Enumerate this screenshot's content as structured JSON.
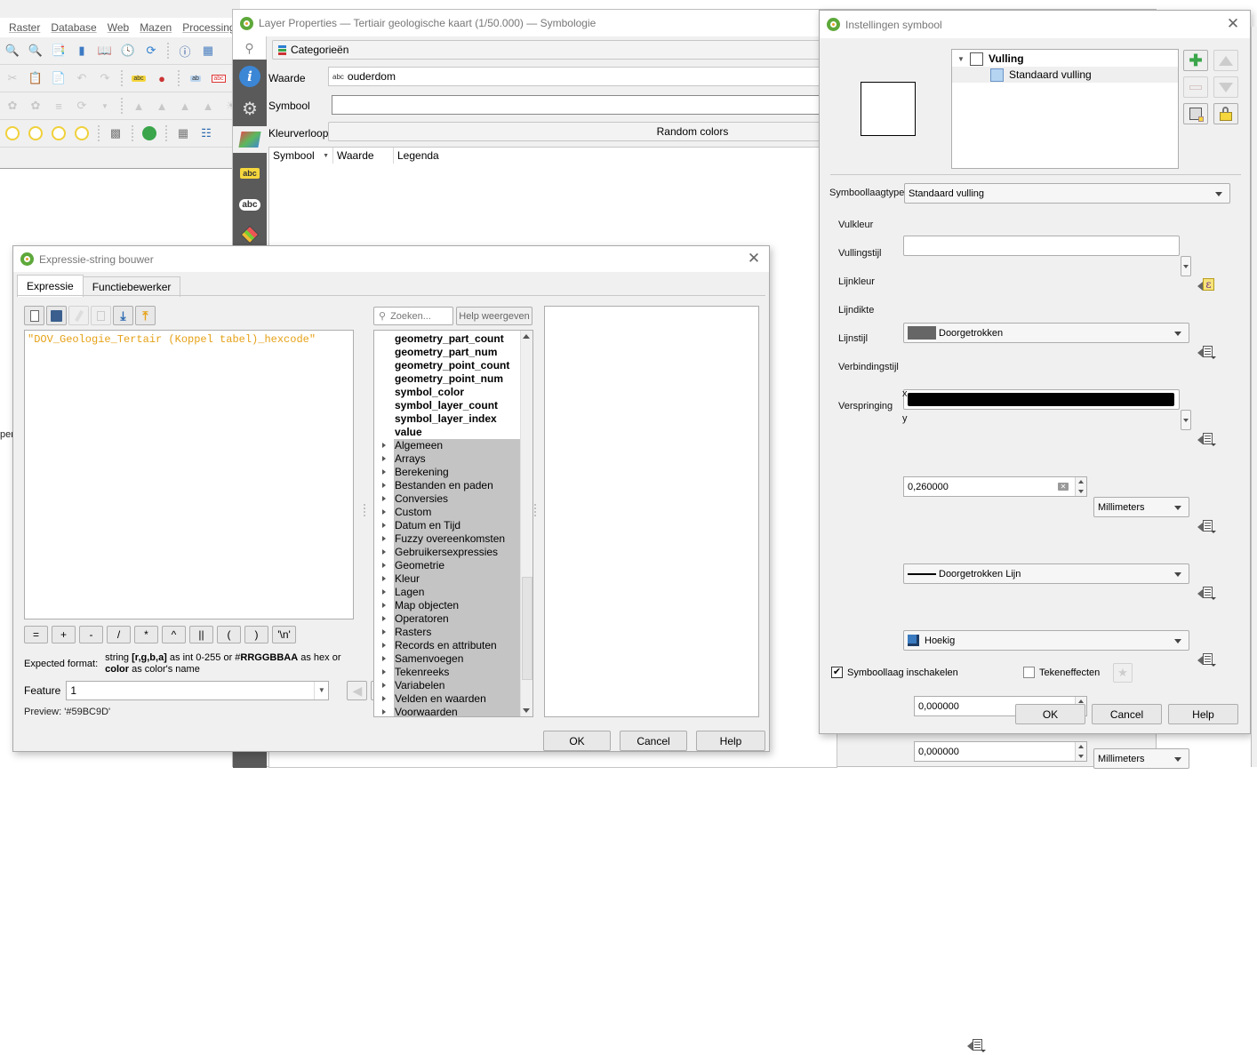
{
  "main_window": {
    "menu": [
      "Raster",
      "Database",
      "Web",
      "Mazen",
      "Processing"
    ],
    "side_text": "pen"
  },
  "layer_properties": {
    "title": "Layer Properties — Tertiair geologische kaart (1/50.000) — Symbologie",
    "renderer": "Categorieën",
    "value_label": "Waarde",
    "value_field": "ouderdom",
    "value_field_type": "abc",
    "symbol_label": "Symbool",
    "color_ramp_label": "Kleurverloop",
    "color_ramp_value": "Random colors",
    "table_headers": [
      "Symbool",
      "Waarde",
      "Legenda"
    ],
    "sidebar_icons": [
      "search-icon",
      "information-icon",
      "source-settings-icon",
      "symbology-icon",
      "labels-icon",
      "masks-icon",
      "3d-view-icon"
    ]
  },
  "expression_builder": {
    "title": "Expressie-string bouwer",
    "tabs": [
      {
        "label": "Expressie",
        "active": true
      },
      {
        "label": "Functiebewerker",
        "active": false
      }
    ],
    "expression": "\"DOV_Geologie_Tertair (Koppel tabel)_hexcode\"",
    "operators": [
      "=",
      "+",
      "-",
      "/",
      "*",
      "^",
      "||",
      "(",
      ")",
      "'\\n'"
    ],
    "expected_format_label": "Expected format:",
    "expected_format": {
      "p1": "string ",
      "b1": "[r,g,b,a]",
      "p2": " as int 0-255 or #",
      "b2": "RRGGBBAA",
      "p3": " as hex or ",
      "b3": "color",
      "p4": " as color's name"
    },
    "feature_label": "Feature",
    "feature_value": "1",
    "preview_label": "Preview:",
    "preview_value": "'#59BC9D'",
    "search_placeholder": "Zoeken...",
    "help_button": "Help weergeven",
    "variables": [
      "geometry_part_count",
      "geometry_part_num",
      "geometry_point_count",
      "geometry_point_num",
      "symbol_color",
      "symbol_layer_count",
      "symbol_layer_index",
      "value"
    ],
    "groups": [
      "Algemeen",
      "Arrays",
      "Berekening",
      "Bestanden en paden",
      "Conversies",
      "Custom",
      "Datum en Tijd",
      "Fuzzy overeenkomsten",
      "Gebruikersexpressies",
      "Geometrie",
      "Kleur",
      "Lagen",
      "Map objecten",
      "Operatoren",
      "Rasters",
      "Records en attributen",
      "Samenvoegen",
      "Tekenreeks",
      "Variabelen",
      "Velden en waarden",
      "Voorwaarden"
    ],
    "buttons": {
      "ok": "OK",
      "cancel": "Cancel",
      "help": "Help"
    }
  },
  "symbol_settings": {
    "title": "Instellingen symbool",
    "tree": {
      "root": "Vulling",
      "child": "Standaard vulling",
      "child_swatch_color": "#b5d4f2"
    },
    "symbol_layer_type_label": "Symboollaagtype",
    "symbol_layer_type": "Standaard vulling",
    "fill_color_label": "Vulkleur",
    "fill_color": "#ffffff",
    "fill_style_label": "Vullingstijl",
    "fill_style": "Doorgetrokken",
    "fill_style_swatch": "#666666",
    "stroke_color_label": "Lijnkleur",
    "stroke_color": "#000000",
    "stroke_width_label": "Lijndikte",
    "stroke_width": "0,260000",
    "stroke_width_unit": "Millimeters",
    "stroke_style_label": "Lijnstijl",
    "stroke_style": "Doorgetrokken Lijn",
    "join_style_label": "Verbindingstijl",
    "join_style": "Hoekig",
    "offset_label": "Verspringing",
    "offset_x_label": "x",
    "offset_x": "0,000000",
    "offset_y_label": "y",
    "offset_y": "0,000000",
    "offset_unit": "Millimeters",
    "enable_layer_label": "Symboollaag inschakelen",
    "enable_layer_checked": true,
    "draw_effects_label": "Tekeneffecten",
    "draw_effects_checked": false,
    "buttons": {
      "ok": "OK",
      "cancel": "Cancel",
      "help": "Help"
    }
  }
}
